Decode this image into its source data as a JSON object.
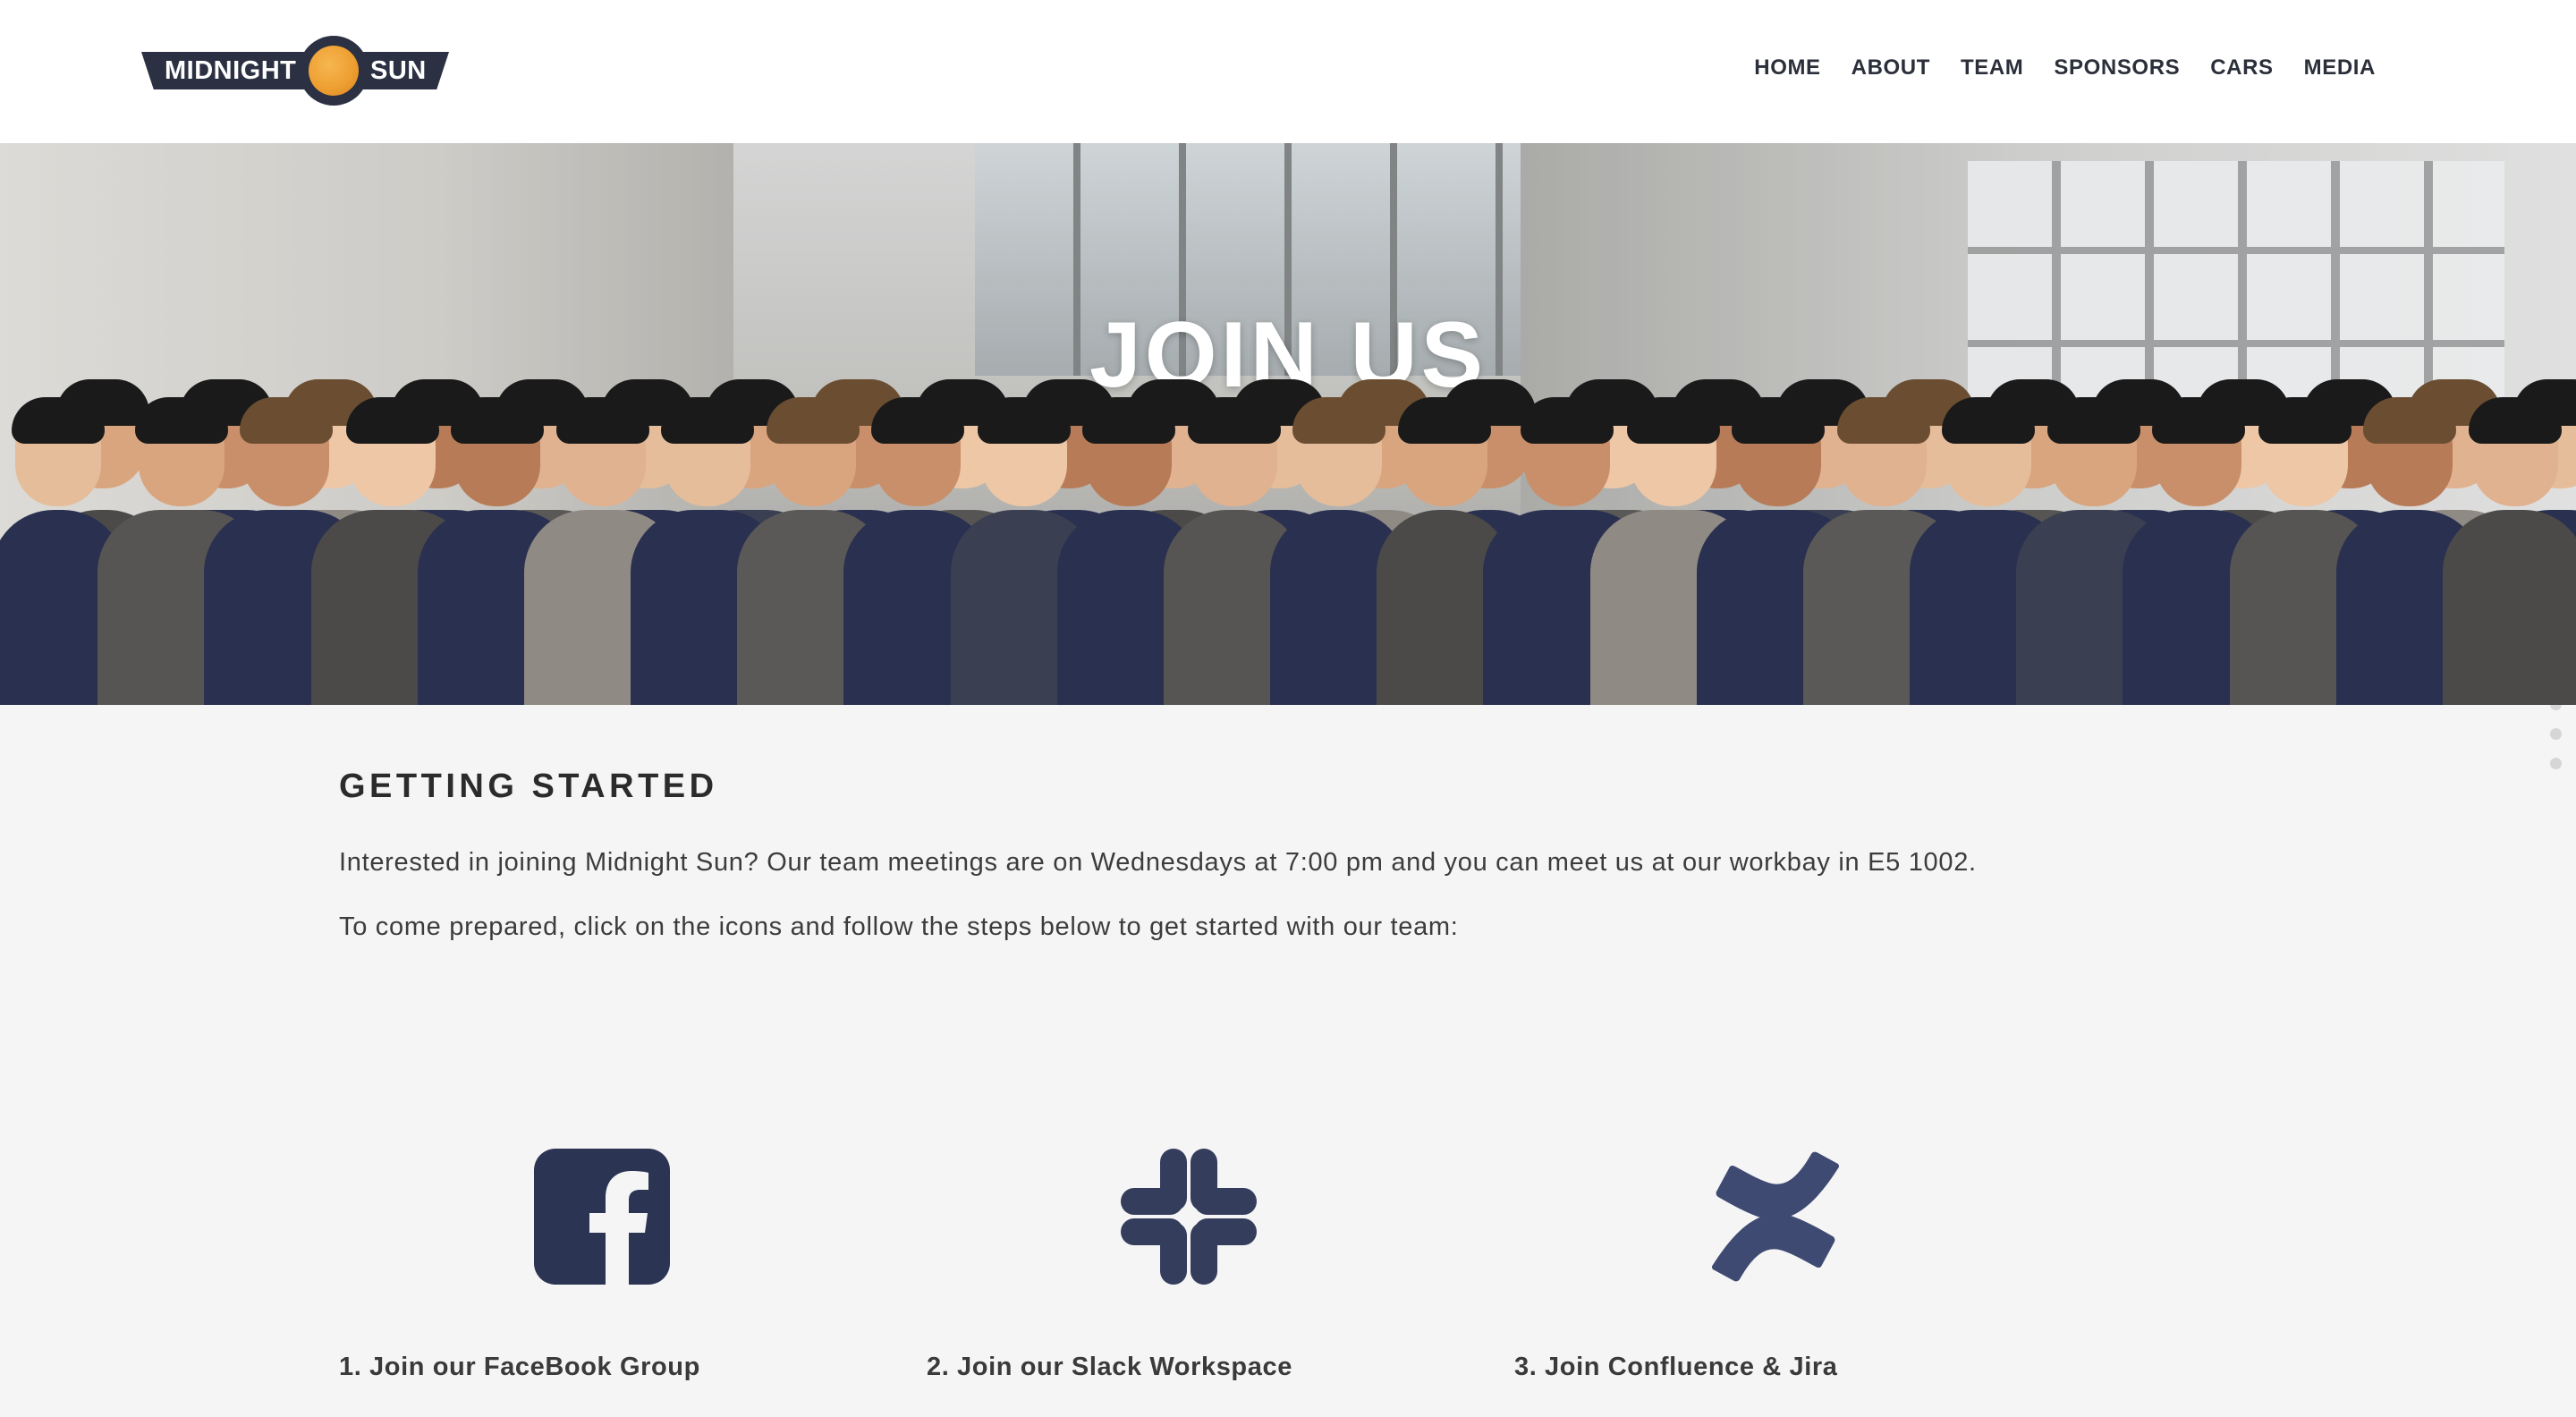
{
  "header": {
    "logo": {
      "left_text": "MIDNIGHT",
      "right_text": "SUN"
    },
    "nav": [
      "HOME",
      "ABOUT",
      "TEAM",
      "SPONSORS",
      "CARS",
      "MEDIA"
    ]
  },
  "hero": {
    "title": "JOIN US"
  },
  "main": {
    "section_title": "GETTING STARTED",
    "paragraph_1": "Interested in joining Midnight Sun? Our team meetings are on Wednesdays at 7:00 pm and you can meet us at our workbay in E5 1002.",
    "paragraph_2": "To come prepared, click on the icons and follow the steps below to get started with our team:",
    "steps": [
      {
        "label": "1. Join our FaceBook Group",
        "icon": "facebook-icon"
      },
      {
        "label": "2. Join our Slack Workspace",
        "icon": "slack-icon"
      },
      {
        "label": "3. Join Confluence & Jira",
        "icon": "confluence-icon"
      }
    ]
  },
  "side_nav": {
    "dot_count": 5
  },
  "colors": {
    "brand_dark": "#2b3142",
    "brand_sun": "#eea032",
    "icon_facebook": "#2b3452",
    "icon_slack": "#343d5c",
    "icon_confluence": "#3f4a72",
    "page_bg": "#f5f5f5"
  }
}
